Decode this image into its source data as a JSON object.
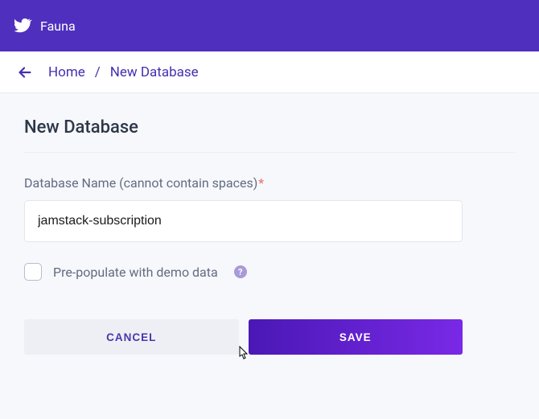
{
  "header": {
    "brand": "Fauna"
  },
  "breadcrumb": {
    "home": "Home",
    "separator": "/",
    "current": "New Database"
  },
  "page": {
    "title": "New Database"
  },
  "form": {
    "name_label": "Database Name (cannot contain spaces)",
    "name_value": "jamstack-subscription",
    "demo_label": "Pre-populate with demo data",
    "help_glyph": "?"
  },
  "buttons": {
    "cancel": "CANCEL",
    "save": "SAVE"
  }
}
